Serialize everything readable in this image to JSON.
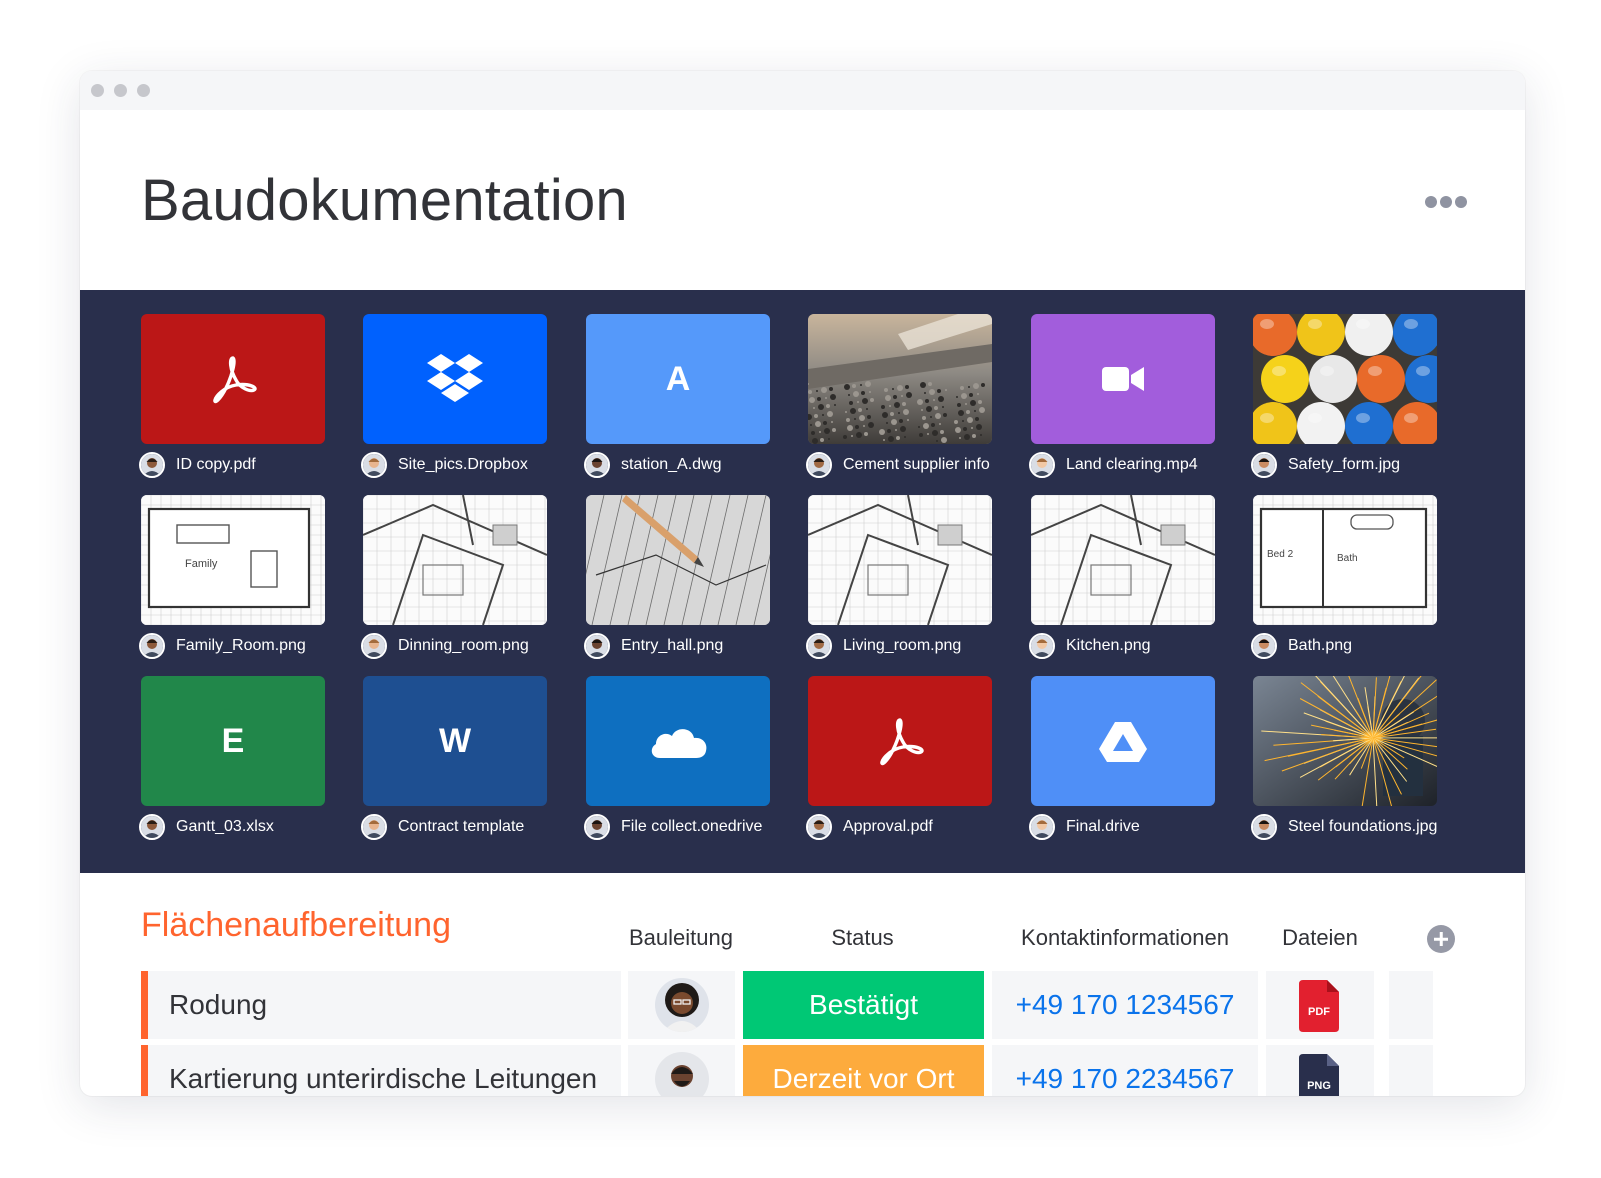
{
  "window": {
    "title": "Baudokumentation",
    "more_icon": "more-horizontal-icon"
  },
  "gallery": [
    {
      "name": "ID copy.pdf",
      "thumb": "pdf",
      "color": "#bb1717",
      "icon": "acrobat-pdf-icon"
    },
    {
      "name": "Site_pics.Dropbox",
      "thumb": "dropbox",
      "color": "#0061fe",
      "icon": "dropbox-icon"
    },
    {
      "name": "station_A.dwg",
      "thumb": "letter",
      "letter": "A",
      "color": "#5599fa",
      "icon": "autocad-icon"
    },
    {
      "name": "Cement supplier info",
      "thumb": "photo-cement",
      "color": "#7b7670"
    },
    {
      "name": "Land clearing.mp4",
      "thumb": "video",
      "color": "#a25ddc",
      "icon": "video-camera-icon"
    },
    {
      "name": "Safety_form.jpg",
      "thumb": "photo-helmets",
      "color": "#5b5b5b"
    },
    {
      "name": "Family_Room.png",
      "thumb": "plan-family",
      "color": "#fbfbfb"
    },
    {
      "name": "Dinning_room.png",
      "thumb": "plan-dining",
      "color": "#f3f3f3"
    },
    {
      "name": "Entry_hall.png",
      "thumb": "plan-pencil",
      "color": "#c9c9c9"
    },
    {
      "name": "Living_room.png",
      "thumb": "plan-living",
      "color": "#f0f0f0"
    },
    {
      "name": "Kitchen.png",
      "thumb": "plan-kitchen",
      "color": "#f2f2f2"
    },
    {
      "name": "Bath.png",
      "thumb": "plan-bath",
      "color": "#fbfbfb"
    },
    {
      "name": "Gantt_03.xlsx",
      "thumb": "letter",
      "letter": "E",
      "color": "#21874a",
      "icon": "excel-icon"
    },
    {
      "name": "Contract template",
      "thumb": "letter",
      "letter": "W",
      "color": "#1e4f91",
      "icon": "word-icon"
    },
    {
      "name": "File collect.onedrive",
      "thumb": "onedrive",
      "color": "#0e6fc0",
      "icon": "onedrive-cloud-icon"
    },
    {
      "name": "Approval.pdf",
      "thumb": "pdf",
      "color": "#bb1717",
      "icon": "acrobat-pdf-icon"
    },
    {
      "name": "Final.drive",
      "thumb": "gdrive",
      "color": "#4f8ff7",
      "icon": "google-drive-icon"
    },
    {
      "name": "Steel foundations.jpg",
      "thumb": "photo-sparks",
      "color": "#2f3640"
    }
  ],
  "board": {
    "group_title": "Flächenaufbereitung",
    "group_color": "#ff642e",
    "columns": {
      "person": "Bauleitung",
      "status": "Status",
      "contact": "Kontaktinformationen",
      "files": "Dateien"
    },
    "add_column_icon": "plus-circle-icon",
    "rows": [
      {
        "name": "Rodung",
        "status": "Bestätigt",
        "status_color": "#00c875",
        "phone": "+49 170 1234567",
        "file": "PDF",
        "file_color": "#e2202f"
      },
      {
        "name": "Kartierung unterirdische Leitungen",
        "status": "Derzeit vor Ort",
        "status_color": "#fdab3d",
        "phone": "+49 170 2234567",
        "file": "PNG",
        "file_color": "#292f4c"
      }
    ]
  }
}
